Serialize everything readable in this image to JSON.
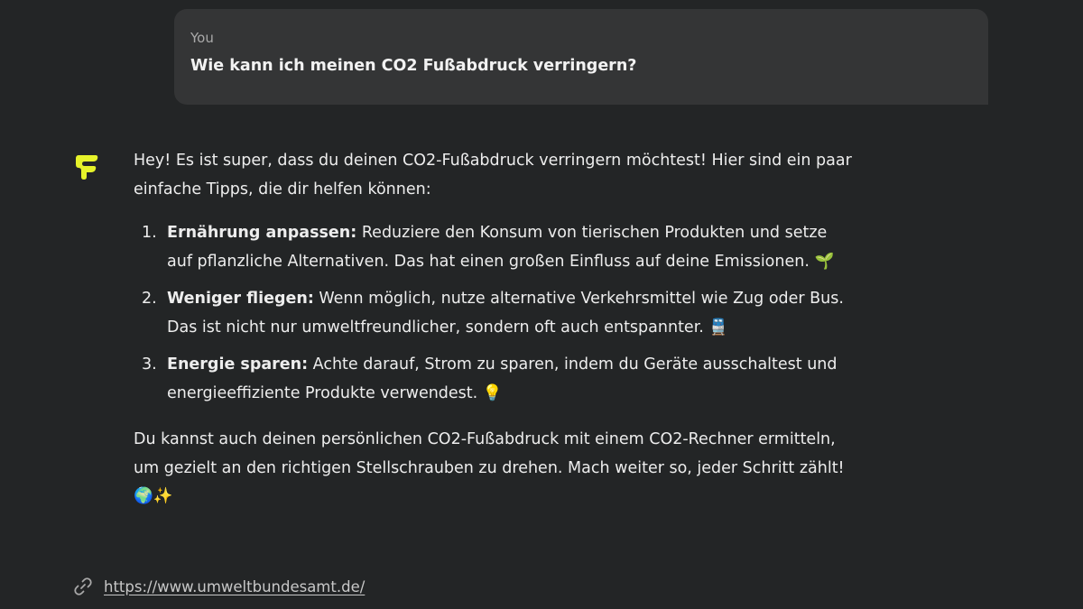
{
  "user_message": {
    "sender": "You",
    "text": "Wie kann ich meinen CO2 Fußabdruck verringern?"
  },
  "assistant": {
    "avatar_icon": "yellow-bot-logo-icon",
    "avatar_color": "#e6f32a",
    "intro": "Hey! Es ist super, dass du deinen CO2-Fußabdruck verringern möchtest! Hier sind ein paar einfache Tipps, die dir helfen können:",
    "tips": [
      {
        "number": "1.",
        "title": "Ernährung anpassen:",
        "text": " Reduziere den Konsum von tierischen Produkten und setze auf pflanzliche Alternativen. Das hat einen großen Einfluss auf deine Emissionen. ",
        "emoji": "🌱",
        "emoji_name": "seedling-icon"
      },
      {
        "number": "2.",
        "title": "Weniger fliegen:",
        "text": " Wenn möglich, nutze alternative Verkehrsmittel wie Zug oder Bus. Das ist nicht nur umweltfreundlicher, sondern oft auch entspannter. ",
        "emoji": "🚆",
        "emoji_name": "train-icon"
      },
      {
        "number": "3.",
        "title": "Energie sparen:",
        "text": " Achte darauf, Strom zu sparen, indem du Geräte ausschaltest und energieeffiziente Produkte verwendest. ",
        "emoji": "💡",
        "emoji_name": "light-bulb-icon"
      }
    ],
    "outro": "Du kannst auch deinen persönlichen CO2-Fußabdruck mit einem CO2-Rechner ermitteln, um gezielt an den richtigen Stellschrauben zu drehen. Mach weiter so, jeder Schritt zählt! ",
    "outro_emoji_globe": "🌍",
    "outro_emoji_sparkles": "✨"
  },
  "source": {
    "icon": "link-icon",
    "url": "https://www.umweltbundesamt.de/"
  },
  "colors": {
    "background": "#232526",
    "user_bubble": "#343536",
    "text": "#ededed",
    "muted": "#a9a9a9"
  }
}
